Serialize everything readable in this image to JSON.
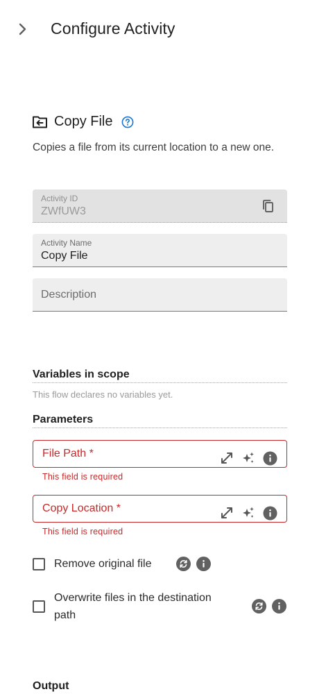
{
  "header": {
    "title": "Configure Activity",
    "collapse_icon": "chevron-right-icon"
  },
  "activity": {
    "title": "Copy File",
    "icon": "folder-move-icon",
    "description": "Copies a file from its current location to a new one."
  },
  "fields": {
    "activity_id": {
      "label": "Activity ID",
      "value": "ZWfUW3"
    },
    "activity_name": {
      "label": "Activity Name",
      "value": "Copy File"
    },
    "description": {
      "placeholder": "Description"
    }
  },
  "variables": {
    "title": "Variables in scope",
    "empty_text": "This flow declares no variables yet."
  },
  "parameters": {
    "title": "Parameters",
    "file_path": {
      "label": "File Path *",
      "error": "This field is required"
    },
    "copy_location": {
      "label": "Copy Location *",
      "error": "This field is required"
    },
    "remove_original": {
      "label": "Remove original file",
      "checked": false
    },
    "overwrite": {
      "label": "Overwrite files in the destination path",
      "checked": false
    }
  },
  "output": {
    "title": "Output"
  },
  "colors": {
    "error": "#c62828",
    "accent": "#1976d2",
    "field_bg": "#eeeeee"
  }
}
